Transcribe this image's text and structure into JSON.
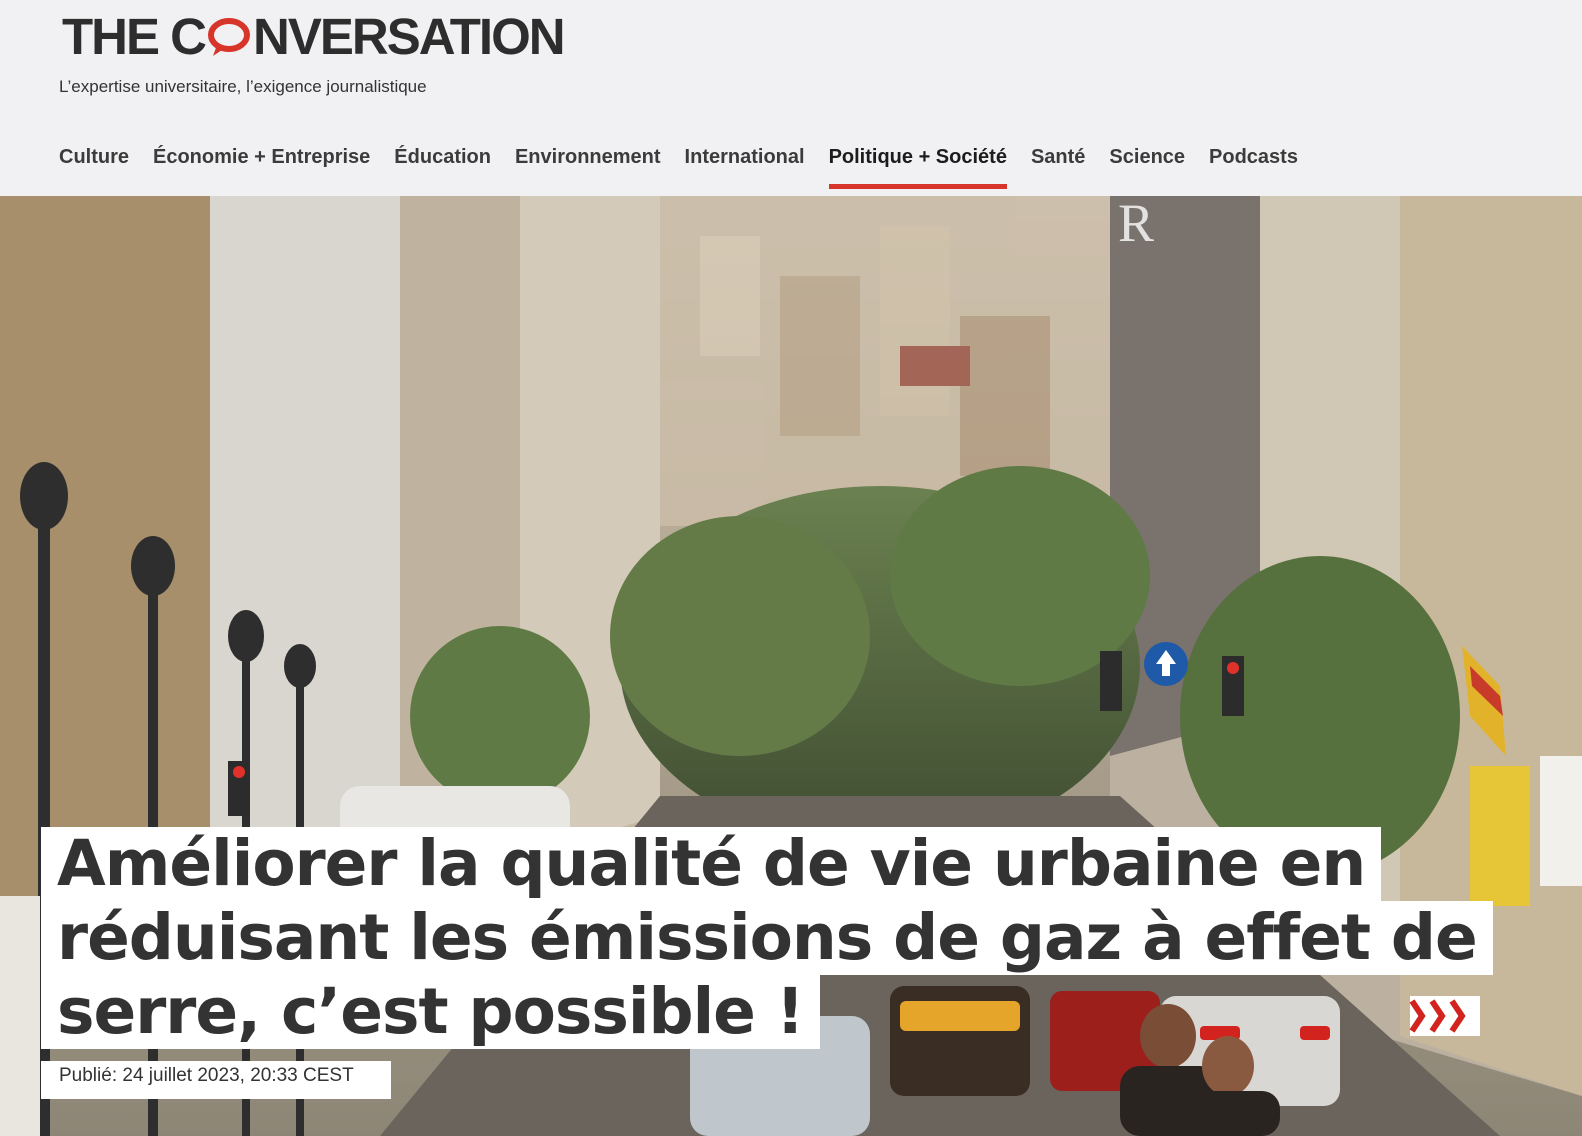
{
  "brand": {
    "logo_before": "THE C",
    "logo_after": "NVERSATION",
    "tagline": "L’expertise universitaire, l’exigence journalistique",
    "accent_color": "#d8352a"
  },
  "nav": {
    "items": [
      {
        "label": "Culture",
        "active": false
      },
      {
        "label": "Économie + Entreprise",
        "active": false
      },
      {
        "label": "Éducation",
        "active": false
      },
      {
        "label": "Environnement",
        "active": false
      },
      {
        "label": "International",
        "active": false
      },
      {
        "label": "Politique + Société",
        "active": true
      },
      {
        "label": "Santé",
        "active": false
      },
      {
        "label": "Science",
        "active": false
      },
      {
        "label": "Podcasts",
        "active": false
      }
    ]
  },
  "article": {
    "title_lines": [
      "Améliorer la qualité de vie urbaine en",
      "réduisant les émissions de gaz à effet de",
      "serre, c’est possible !"
    ],
    "published": "Publié: 24 juillet 2023, 20:33 CEST"
  },
  "hero_image": {
    "description_icon": "city-street-photo"
  }
}
